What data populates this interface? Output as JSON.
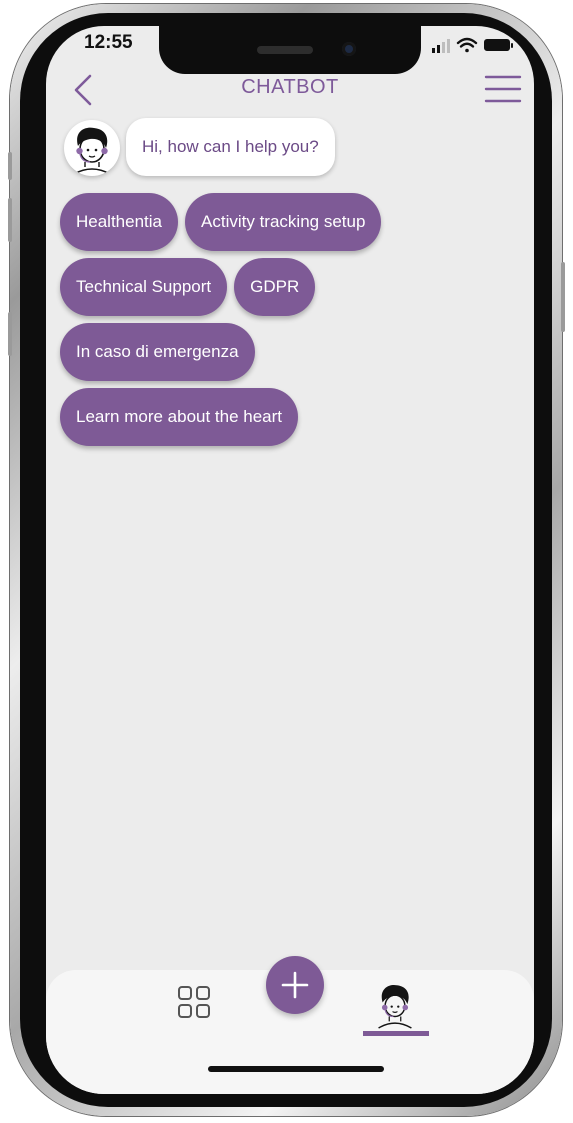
{
  "status_bar": {
    "time": "12:55"
  },
  "header": {
    "title": "CHATBOT",
    "back_icon": "chevron-left-icon",
    "menu_icon": "hamburger-menu-icon"
  },
  "chat": {
    "bot_avatar_icon": "chatbot-avatar-icon",
    "greeting": "Hi, how can I help you?"
  },
  "options": [
    [
      "Healthentia",
      "Activity tracking setup"
    ],
    [
      "Technical Support",
      "GDPR"
    ],
    [
      "In caso di emergenza"
    ],
    [
      "Learn more about the heart"
    ]
  ],
  "bottom_nav": {
    "grid_icon": "dashboard-grid-icon",
    "add_icon": "plus-icon",
    "chatbot_icon": "chatbot-avatar-icon",
    "active_tab": "chatbot"
  },
  "colors": {
    "accent": "#7e5a96",
    "title": "#7e5a9a",
    "background": "#ececec"
  }
}
